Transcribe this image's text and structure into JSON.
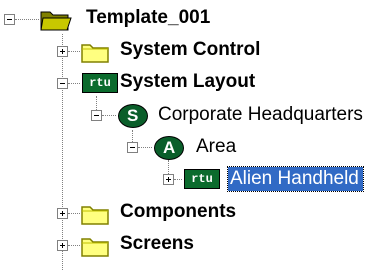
{
  "tree": {
    "root": {
      "label": "Template_001",
      "icon": "open-folder-icon"
    },
    "system_control": {
      "label": "System Control",
      "icon": "folder-icon"
    },
    "system_layout": {
      "label": "System Layout",
      "icon": "rtu-plus-icon",
      "icon_text": "rtu"
    },
    "corporate_hq": {
      "label": "Corporate Headquarters",
      "icon": "site-icon",
      "icon_text": "S"
    },
    "area": {
      "label": "Area",
      "icon": "area-icon",
      "icon_text": "A"
    },
    "alien_handheld": {
      "label": "Alien Handheld",
      "icon": "rtu-icon",
      "icon_text": "rtu",
      "selected": true
    },
    "components": {
      "label": "Components",
      "icon": "folder-icon"
    },
    "screens": {
      "label": "Screens",
      "icon": "folder-icon"
    }
  },
  "colors": {
    "folder_yellow": "#ffff80",
    "folder_dark": "#c0c000",
    "rtu_green": "#0b6b2d",
    "selection_blue": "#316ac5"
  }
}
